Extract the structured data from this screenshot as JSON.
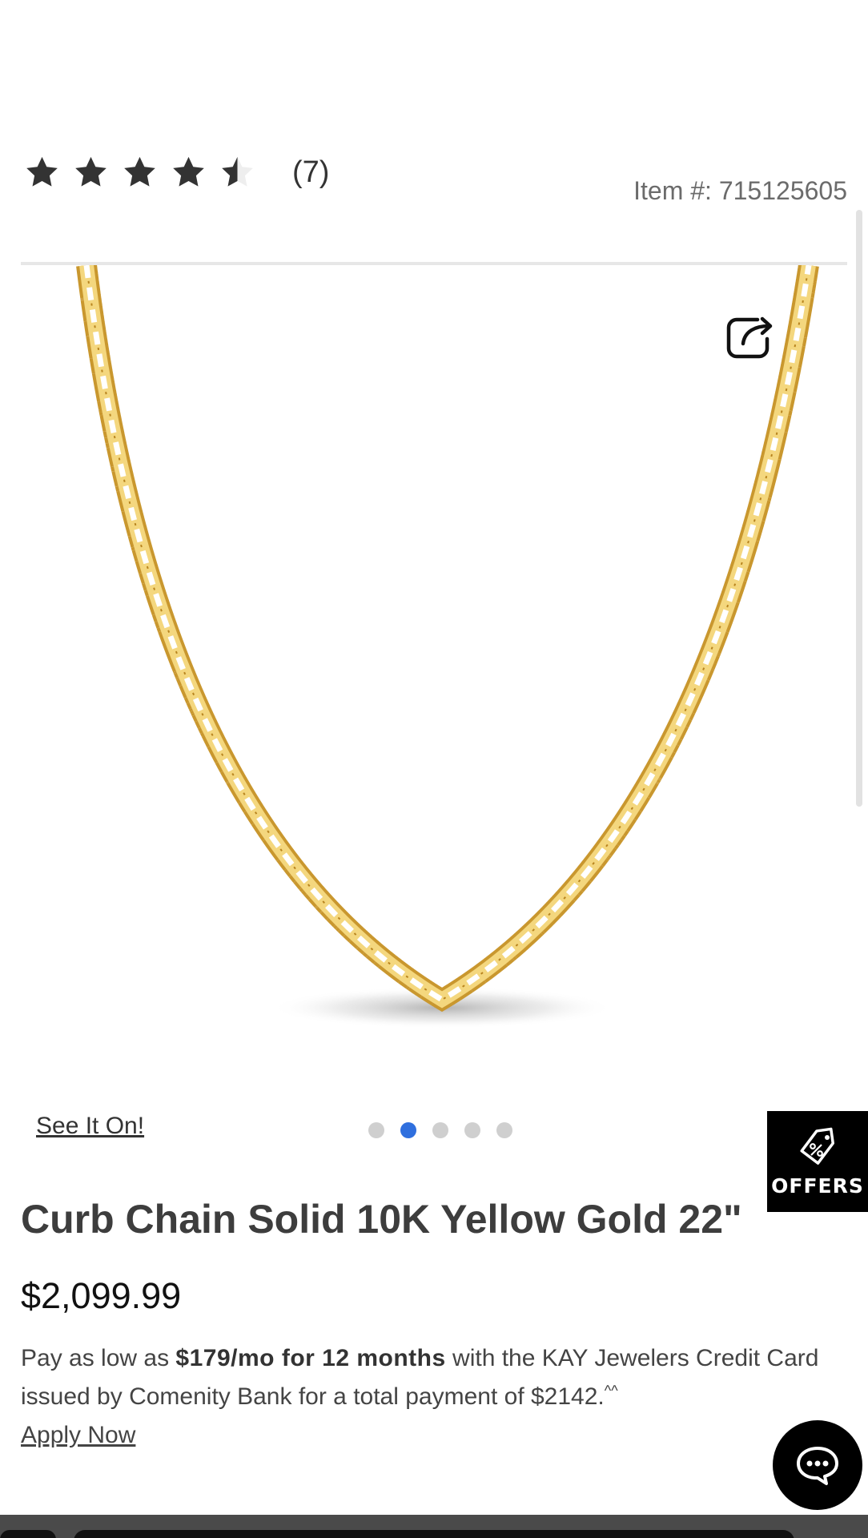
{
  "rating": {
    "value": 4.5,
    "max": 5,
    "review_count": "(7)"
  },
  "item_number": "Item #: 715125605",
  "product": {
    "title": "Curb Chain Solid 10K Yellow Gold 22\"",
    "price": "$2,099.99",
    "image_icon": "gold-curb-chain-necklace"
  },
  "share": {
    "icon": "share-icon"
  },
  "see_it_on": "See It On!",
  "carousel": {
    "total": 5,
    "active_index": 1
  },
  "offers": {
    "label": "OFFERS",
    "icon": "tag-percent-icon"
  },
  "financing": {
    "prefix": "Pay as low as ",
    "highlight": "$179/mo for 12 months",
    "suffix": " with the KAY Jewelers Credit Card issued by Comenity Bank for a total payment of $2142.",
    "footnote": "^^",
    "apply_label": "Apply Now"
  },
  "chat": {
    "icon": "chat-bubble-icon"
  },
  "colors": {
    "active_dot": "#2f6fde",
    "inactive_dot": "#cfcfcf",
    "gold": "#e8c15a",
    "star": "#333333"
  }
}
